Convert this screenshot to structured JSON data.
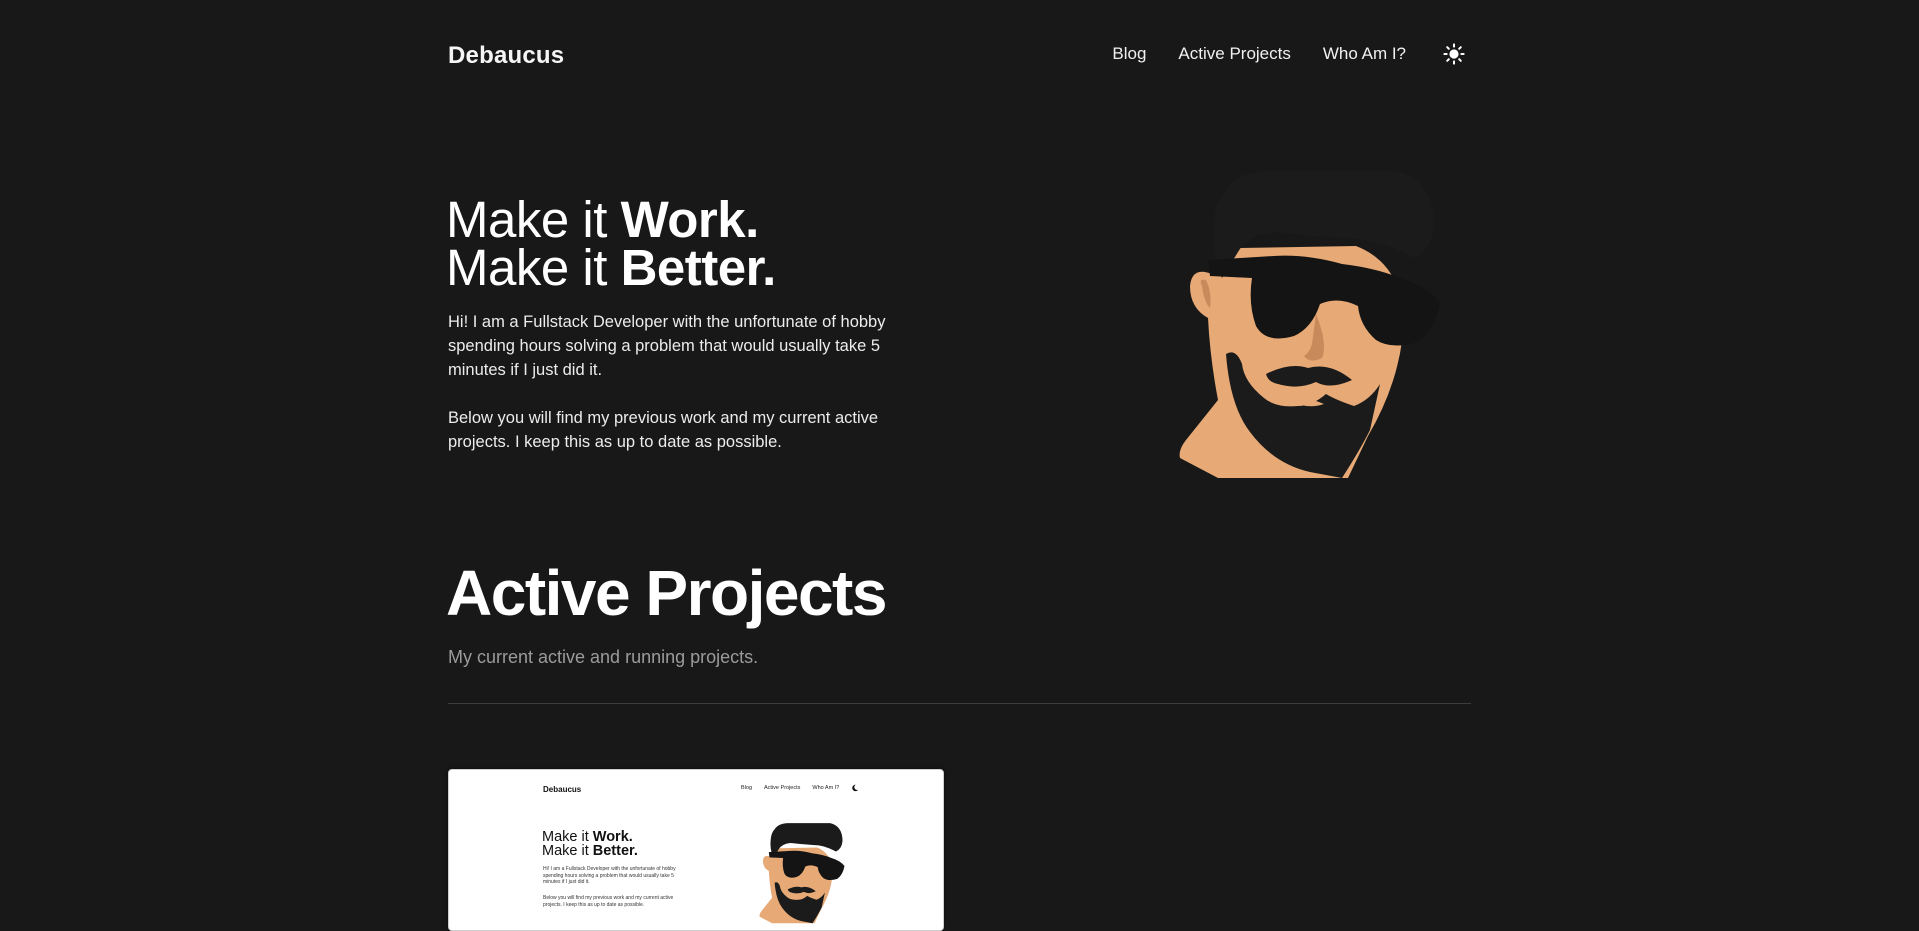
{
  "header": {
    "brand": "Debaucus",
    "nav": [
      "Blog",
      "Active Projects",
      "Who Am I?"
    ],
    "theme_icon": "sun-icon"
  },
  "hero": {
    "line1_prefix": "Make it ",
    "line1_bold": "Work.",
    "line2_prefix": "Make it ",
    "line2_bold": "Better.",
    "para1": "Hi! I am a Fullstack Developer with the unfortunate of hobby spending hours solving a problem that would usually take 5 minutes if I just did it.",
    "para2": "Below you will find my previous work and my current active projects. I keep this as up to date as possible.",
    "avatar_icon": "bearded-man-sunglasses-avatar"
  },
  "active_projects": {
    "title": "Active Projects",
    "subtitle": "My current active and running projects."
  },
  "project_card": {
    "brand": "Debaucus",
    "nav": [
      "Blog",
      "Active Projects",
      "Who Am I?"
    ],
    "theme_icon": "moon-icon",
    "line1_prefix": "Make it ",
    "line1_bold": "Work.",
    "line2_prefix": "Make it ",
    "line2_bold": "Better.",
    "para1": "Hi! I am a Fullstack Developer with the unfortunate of hobby spending hours solving a problem that would usually take 5 minutes if I just did it.",
    "para2": "Below you will find my previous work and my current active projects. I keep this as up to date as possible."
  },
  "colors": {
    "background": "#181818",
    "skin": "#e7a975",
    "hair": "#1b1b1b",
    "divider": "#3c3c3c",
    "muted_text": "#9b9b9b"
  }
}
